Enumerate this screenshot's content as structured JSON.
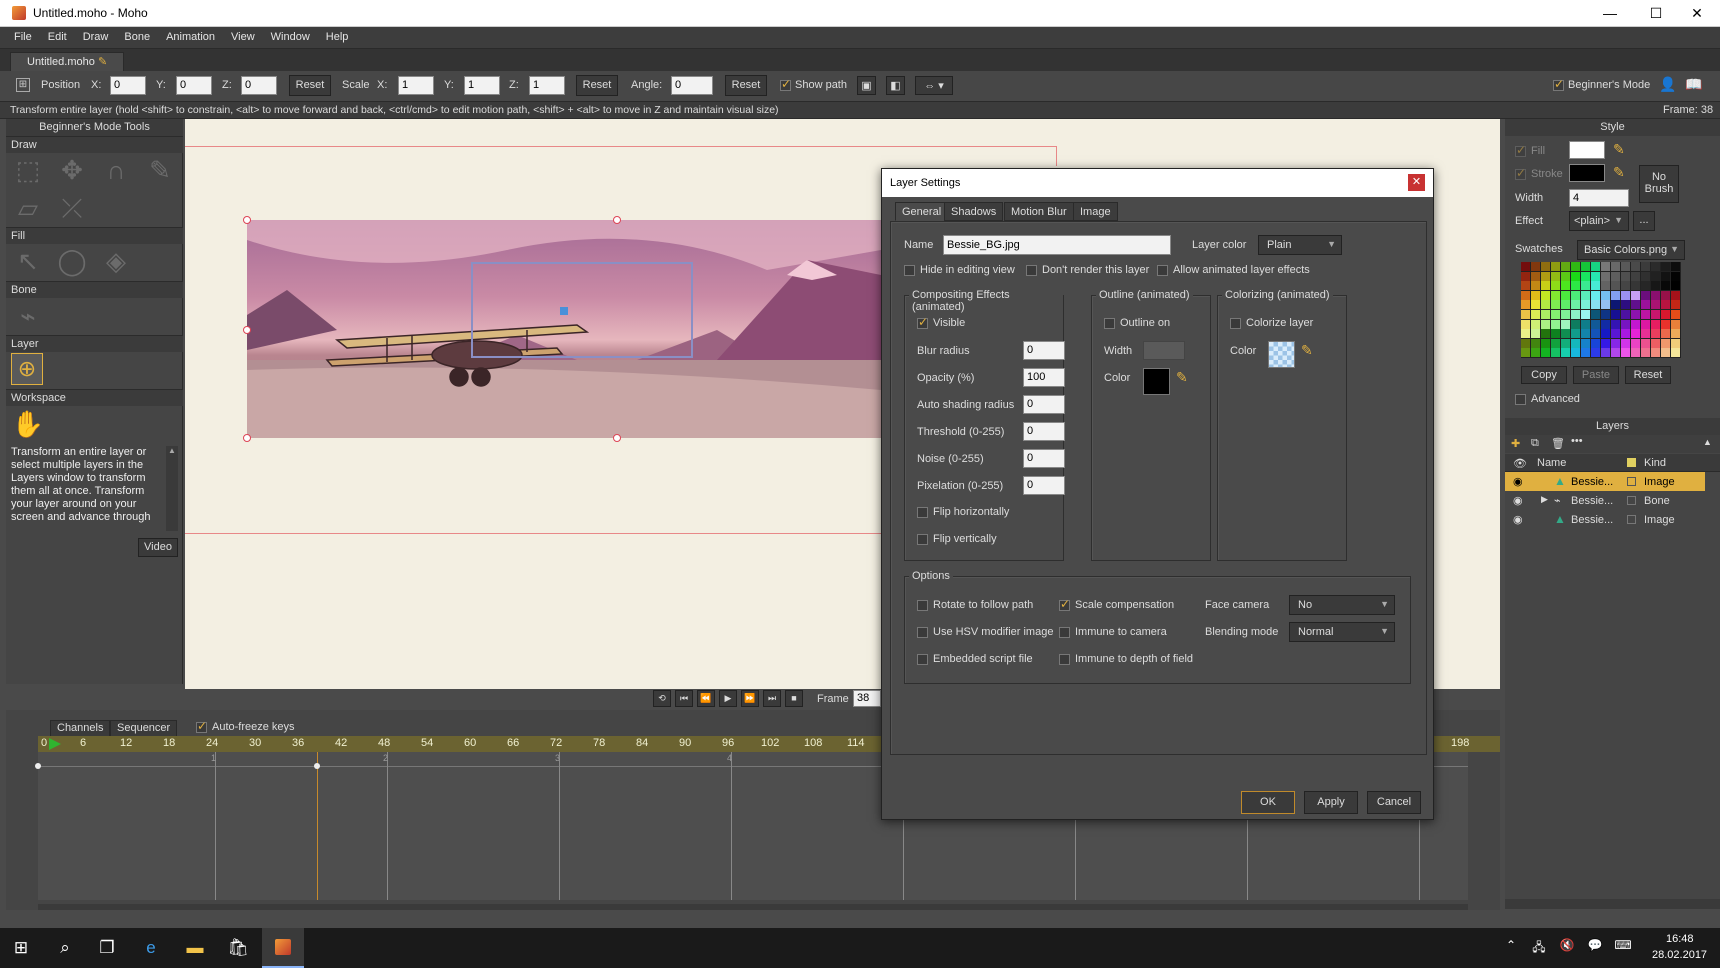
{
  "window": {
    "title": "Untitled.moho - Moho",
    "minimize": "—",
    "maximize": "☐",
    "close": "✕"
  },
  "menu": [
    "File",
    "Edit",
    "Draw",
    "Bone",
    "Animation",
    "View",
    "Window",
    "Help"
  ],
  "doc_tab": "Untitled.moho",
  "toolbar": {
    "position_label": "Position",
    "x_label": "X:",
    "y_label": "Y:",
    "z_label": "Z:",
    "pos_x": "0",
    "pos_y": "0",
    "pos_z": "0",
    "reset1": "Reset",
    "scale_label": "Scale",
    "scale_x": "1",
    "scale_y": "1",
    "scale_z": "1",
    "reset2": "Reset",
    "angle_label": "Angle:",
    "angle": "0",
    "reset3": "Reset",
    "show_path": "Show path",
    "beginners_mode": "Beginner's Mode"
  },
  "status": {
    "hint": "Transform entire layer (hold <shift> to constrain, <alt> to move forward and back, <ctrl/cmd> to edit motion path, <shift> + <alt> to move in Z and maintain visual size)",
    "frame": "Frame: 38"
  },
  "left_panel": {
    "title": "Beginner's Mode Tools",
    "sections": {
      "draw": "Draw",
      "fill": "Fill",
      "bone": "Bone",
      "layer": "Layer",
      "workspace": "Workspace"
    },
    "help_text": "Transform an entire layer or select multiple layers in the Layers window to transform them all at once. Transform your layer around on your screen and advance through",
    "video_button": "Video"
  },
  "dialog": {
    "title": "Layer Settings",
    "tabs": [
      "General",
      "Shadows",
      "Motion Blur",
      "Image"
    ],
    "name_label": "Name",
    "name_value": "Bessie_BG.jpg",
    "layer_color_label": "Layer color",
    "layer_color_value": "Plain",
    "hide_editing": "Hide in editing view",
    "dont_render": "Don't render this layer",
    "allow_anim": "Allow animated layer effects",
    "compositing": {
      "title": "Compositing Effects (animated)",
      "visible": "Visible",
      "blur_label": "Blur radius",
      "blur": "0",
      "opacity_label": "Opacity (%)",
      "opacity": "100",
      "auto_shading_label": "Auto shading radius",
      "auto_shading": "0",
      "threshold_label": "Threshold (0-255)",
      "threshold": "0",
      "noise_label": "Noise (0-255)",
      "noise": "0",
      "pixelation_label": "Pixelation (0-255)",
      "pixelation": "0",
      "flip_h": "Flip horizontally",
      "flip_v": "Flip vertically"
    },
    "outline": {
      "title": "Outline (animated)",
      "outline_on": "Outline on",
      "width_label": "Width",
      "color_label": "Color"
    },
    "colorizing": {
      "title": "Colorizing (animated)",
      "colorize": "Colorize layer",
      "color_label": "Color"
    },
    "options": {
      "title": "Options",
      "rotate": "Rotate to follow path",
      "scale_comp": "Scale compensation",
      "face_camera_label": "Face camera",
      "face_camera": "No",
      "hsv": "Use HSV modifier image",
      "immune_camera": "Immune to camera",
      "blending_label": "Blending mode",
      "blending": "Normal",
      "embedded": "Embedded script file",
      "immune_dof": "Immune to depth of field"
    },
    "ok": "OK",
    "apply": "Apply",
    "cancel": "Cancel"
  },
  "style_panel": {
    "title": "Style",
    "fill": "Fill",
    "stroke": "Stroke",
    "no_brush": "No Brush",
    "width_label": "Width",
    "width": "4",
    "effect_label": "Effect",
    "effect": "<plain>",
    "more": "...",
    "swatches_label": "Swatches",
    "swatches_file": "Basic Colors.png",
    "copy": "Copy",
    "paste": "Paste",
    "reset": "Reset",
    "advanced": "Advanced"
  },
  "layers_panel": {
    "title": "Layers",
    "col_name": "Name",
    "col_kind": "Kind",
    "rows": [
      {
        "name": "Bessie...",
        "kind": "Image"
      },
      {
        "name": "Bessie...",
        "kind": "Bone"
      },
      {
        "name": "Bessie...",
        "kind": "Image"
      }
    ]
  },
  "transport": {
    "frame_label": "Frame",
    "frame": "38"
  },
  "timeline": {
    "tabs": [
      "Channels",
      "Sequencer"
    ],
    "auto_freeze": "Auto-freeze keys",
    "ticks": [
      "0",
      "6",
      "12",
      "18",
      "24",
      "30",
      "36",
      "42",
      "48",
      "54",
      "60",
      "66",
      "72",
      "78",
      "84",
      "90",
      "96",
      "102",
      "108",
      "114",
      "198"
    ],
    "markers": [
      "1",
      "2",
      "3",
      "4"
    ]
  },
  "taskbar": {
    "time": "16:48",
    "date": "28.02.2017"
  },
  "colors": {
    "accent": "#e0b040",
    "panel": "#454545",
    "dark": "#3b3b3b"
  }
}
